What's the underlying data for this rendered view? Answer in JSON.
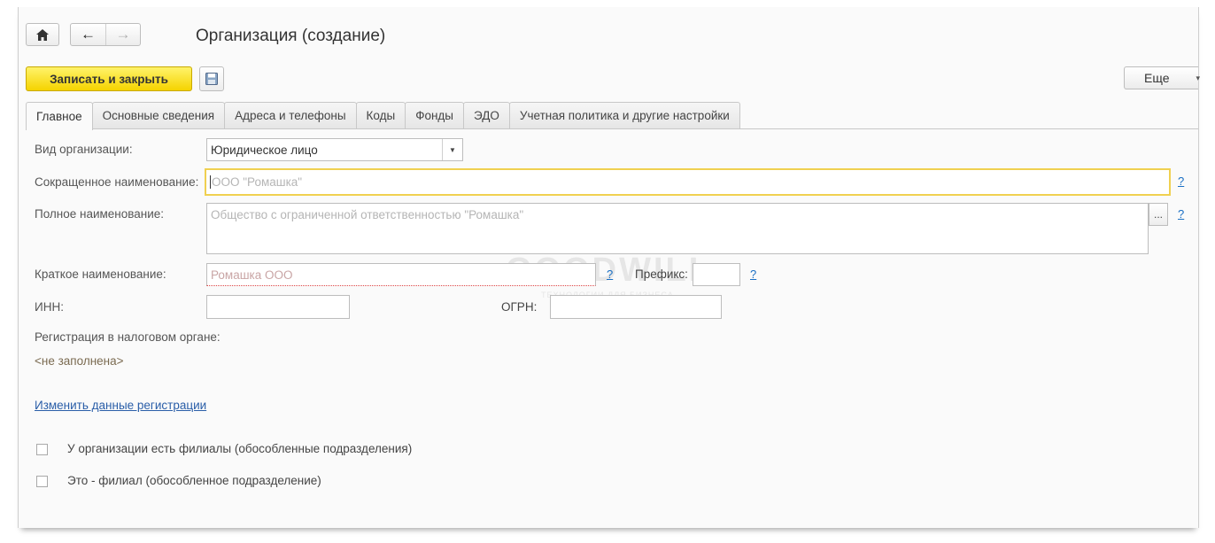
{
  "window": {
    "title": "Организация (создание)"
  },
  "toolbar": {
    "save_close_label": "Записать и закрыть",
    "more_label": "Еще"
  },
  "tabs": [
    {
      "label": "Главное"
    },
    {
      "label": "Основные сведения"
    },
    {
      "label": "Адреса и телефоны"
    },
    {
      "label": "Коды"
    },
    {
      "label": "Фонды"
    },
    {
      "label": "ЭДО"
    },
    {
      "label": "Учетная политика и другие настройки"
    }
  ],
  "form": {
    "org_type": {
      "label": "Вид организации:",
      "value": "Юридическое лицо"
    },
    "short_name": {
      "label": "Сокращенное наименование:",
      "placeholder": "ООО \"Ромашка\"",
      "help": "?"
    },
    "full_name": {
      "label": "Полное наименование:",
      "placeholder": "Общество с ограниченной ответственностью \"Ромашка\"",
      "select_label": "...",
      "help": "?"
    },
    "brief_name": {
      "label": "Краткое наименование:",
      "placeholder": "Ромашка ООО",
      "help": "?"
    },
    "prefix": {
      "label": "Префикс:",
      "value": "",
      "help": "?"
    },
    "inn": {
      "label": "ИНН:",
      "value": ""
    },
    "ogrn": {
      "label": "ОГРН:",
      "value": ""
    },
    "tax_registration": {
      "label": "Регистрация в налоговом органе:",
      "value": "<не заполнена>"
    },
    "change_registration_link": "Изменить данные регистрации",
    "has_branches": {
      "label": "У организации есть филиалы (обособленные подразделения)",
      "checked": false
    },
    "is_branch": {
      "label": "Это - филиал (обособленное подразделение)",
      "checked": false
    }
  },
  "watermark": {
    "top": "БЛОГ КОМПАНИИ",
    "brand": "GOODWILL",
    "bottom": "ТЕХНОЛОГИИ ДЛЯ БИЗНЕСА"
  }
}
